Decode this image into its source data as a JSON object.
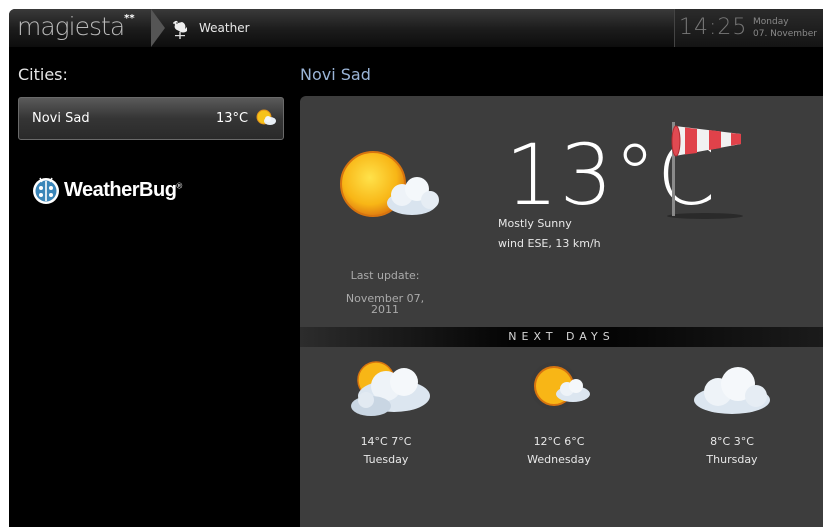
{
  "app": {
    "logo": "magiesta",
    "logo_mark": "**",
    "breadcrumb": "Weather"
  },
  "clock": {
    "time": "14:25",
    "day": "Monday",
    "date": "07. November"
  },
  "sidebar": {
    "title": "Cities:",
    "cities": [
      {
        "name": "Novi Sad",
        "temp": "13°C",
        "icon": "partly-sunny-icon"
      }
    ],
    "provider": {
      "name": "WeatherBug",
      "mark": "®"
    }
  },
  "current": {
    "city": "Novi Sad",
    "temp": "13°C",
    "condition": "Mostly Sunny",
    "wind": "wind ESE, 13 km/h",
    "last_update_label": "Last update:",
    "last_update_date": "November 07, 2011"
  },
  "next_days": {
    "label": "NEXT DAYS",
    "days": [
      {
        "temps": "14°C 7°C",
        "name": "Tuesday",
        "icon": "partly-cloudy-icon"
      },
      {
        "temps": "12°C 6°C",
        "name": "Wednesday",
        "icon": "mostly-sunny-icon"
      },
      {
        "temps": "8°C 3°C",
        "name": "Thursday",
        "icon": "cloudy-icon"
      }
    ]
  },
  "colors": {
    "accent": "#9ab4d6",
    "panel": "#3d3d3d",
    "background": "#000000"
  }
}
